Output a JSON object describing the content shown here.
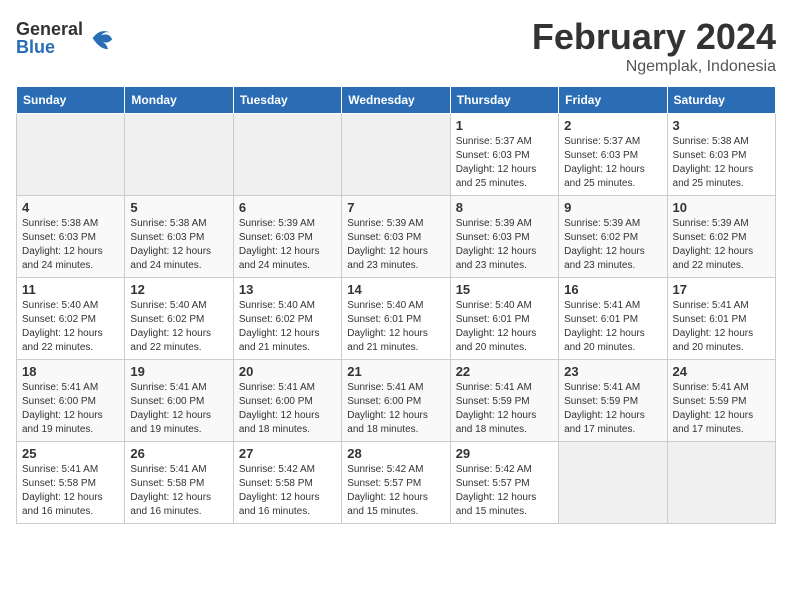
{
  "header": {
    "logo_general": "General",
    "logo_blue": "Blue",
    "month_title": "February 2024",
    "location": "Ngemplak, Indonesia"
  },
  "weekdays": [
    "Sunday",
    "Monday",
    "Tuesday",
    "Wednesday",
    "Thursday",
    "Friday",
    "Saturday"
  ],
  "weeks": [
    [
      {
        "day": "",
        "info": ""
      },
      {
        "day": "",
        "info": ""
      },
      {
        "day": "",
        "info": ""
      },
      {
        "day": "",
        "info": ""
      },
      {
        "day": "1",
        "info": "Sunrise: 5:37 AM\nSunset: 6:03 PM\nDaylight: 12 hours\nand 25 minutes."
      },
      {
        "day": "2",
        "info": "Sunrise: 5:37 AM\nSunset: 6:03 PM\nDaylight: 12 hours\nand 25 minutes."
      },
      {
        "day": "3",
        "info": "Sunrise: 5:38 AM\nSunset: 6:03 PM\nDaylight: 12 hours\nand 25 minutes."
      }
    ],
    [
      {
        "day": "4",
        "info": "Sunrise: 5:38 AM\nSunset: 6:03 PM\nDaylight: 12 hours\nand 24 minutes."
      },
      {
        "day": "5",
        "info": "Sunrise: 5:38 AM\nSunset: 6:03 PM\nDaylight: 12 hours\nand 24 minutes."
      },
      {
        "day": "6",
        "info": "Sunrise: 5:39 AM\nSunset: 6:03 PM\nDaylight: 12 hours\nand 24 minutes."
      },
      {
        "day": "7",
        "info": "Sunrise: 5:39 AM\nSunset: 6:03 PM\nDaylight: 12 hours\nand 23 minutes."
      },
      {
        "day": "8",
        "info": "Sunrise: 5:39 AM\nSunset: 6:03 PM\nDaylight: 12 hours\nand 23 minutes."
      },
      {
        "day": "9",
        "info": "Sunrise: 5:39 AM\nSunset: 6:02 PM\nDaylight: 12 hours\nand 23 minutes."
      },
      {
        "day": "10",
        "info": "Sunrise: 5:39 AM\nSunset: 6:02 PM\nDaylight: 12 hours\nand 22 minutes."
      }
    ],
    [
      {
        "day": "11",
        "info": "Sunrise: 5:40 AM\nSunset: 6:02 PM\nDaylight: 12 hours\nand 22 minutes."
      },
      {
        "day": "12",
        "info": "Sunrise: 5:40 AM\nSunset: 6:02 PM\nDaylight: 12 hours\nand 22 minutes."
      },
      {
        "day": "13",
        "info": "Sunrise: 5:40 AM\nSunset: 6:02 PM\nDaylight: 12 hours\nand 21 minutes."
      },
      {
        "day": "14",
        "info": "Sunrise: 5:40 AM\nSunset: 6:01 PM\nDaylight: 12 hours\nand 21 minutes."
      },
      {
        "day": "15",
        "info": "Sunrise: 5:40 AM\nSunset: 6:01 PM\nDaylight: 12 hours\nand 20 minutes."
      },
      {
        "day": "16",
        "info": "Sunrise: 5:41 AM\nSunset: 6:01 PM\nDaylight: 12 hours\nand 20 minutes."
      },
      {
        "day": "17",
        "info": "Sunrise: 5:41 AM\nSunset: 6:01 PM\nDaylight: 12 hours\nand 20 minutes."
      }
    ],
    [
      {
        "day": "18",
        "info": "Sunrise: 5:41 AM\nSunset: 6:00 PM\nDaylight: 12 hours\nand 19 minutes."
      },
      {
        "day": "19",
        "info": "Sunrise: 5:41 AM\nSunset: 6:00 PM\nDaylight: 12 hours\nand 19 minutes."
      },
      {
        "day": "20",
        "info": "Sunrise: 5:41 AM\nSunset: 6:00 PM\nDaylight: 12 hours\nand 18 minutes."
      },
      {
        "day": "21",
        "info": "Sunrise: 5:41 AM\nSunset: 6:00 PM\nDaylight: 12 hours\nand 18 minutes."
      },
      {
        "day": "22",
        "info": "Sunrise: 5:41 AM\nSunset: 5:59 PM\nDaylight: 12 hours\nand 18 minutes."
      },
      {
        "day": "23",
        "info": "Sunrise: 5:41 AM\nSunset: 5:59 PM\nDaylight: 12 hours\nand 17 minutes."
      },
      {
        "day": "24",
        "info": "Sunrise: 5:41 AM\nSunset: 5:59 PM\nDaylight: 12 hours\nand 17 minutes."
      }
    ],
    [
      {
        "day": "25",
        "info": "Sunrise: 5:41 AM\nSunset: 5:58 PM\nDaylight: 12 hours\nand 16 minutes."
      },
      {
        "day": "26",
        "info": "Sunrise: 5:41 AM\nSunset: 5:58 PM\nDaylight: 12 hours\nand 16 minutes."
      },
      {
        "day": "27",
        "info": "Sunrise: 5:42 AM\nSunset: 5:58 PM\nDaylight: 12 hours\nand 16 minutes."
      },
      {
        "day": "28",
        "info": "Sunrise: 5:42 AM\nSunset: 5:57 PM\nDaylight: 12 hours\nand 15 minutes."
      },
      {
        "day": "29",
        "info": "Sunrise: 5:42 AM\nSunset: 5:57 PM\nDaylight: 12 hours\nand 15 minutes."
      },
      {
        "day": "",
        "info": ""
      },
      {
        "day": "",
        "info": ""
      }
    ]
  ]
}
